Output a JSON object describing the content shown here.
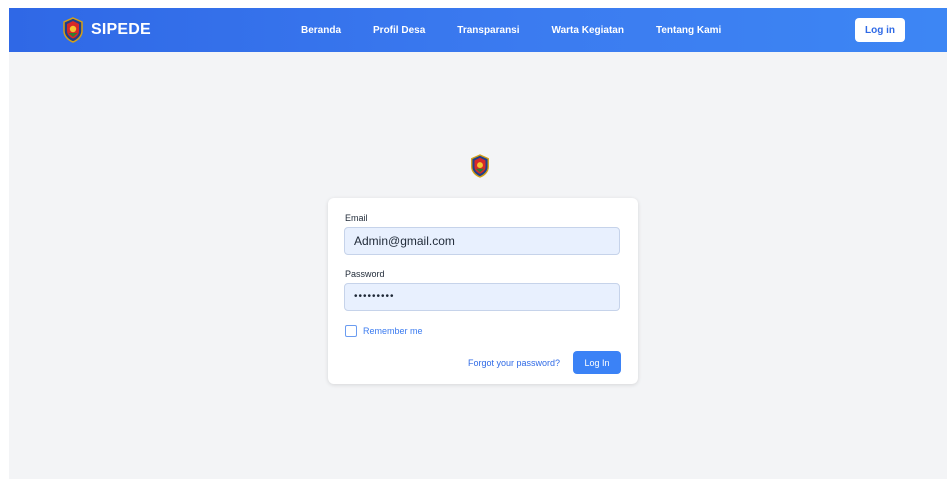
{
  "navbar": {
    "brand": "SIPEDE",
    "links": [
      "Beranda",
      "Profil Desa",
      "Transparansi",
      "Warta Kegiatan",
      "Tentang Kami"
    ],
    "login_label": "Log in"
  },
  "login_form": {
    "email_label": "Email",
    "email_value": "Admin@gmail.com",
    "password_label": "Password",
    "password_value": "•••••••••",
    "remember_label": "Remember me",
    "remember_checked": false,
    "forgot_label": "Forgot your password?",
    "submit_label": "Log In"
  },
  "colors": {
    "navbar": "#3b7bf0",
    "accent": "#3b82f6",
    "background": "#f3f4f6"
  },
  "icons": {
    "brand": "village-emblem-icon"
  }
}
